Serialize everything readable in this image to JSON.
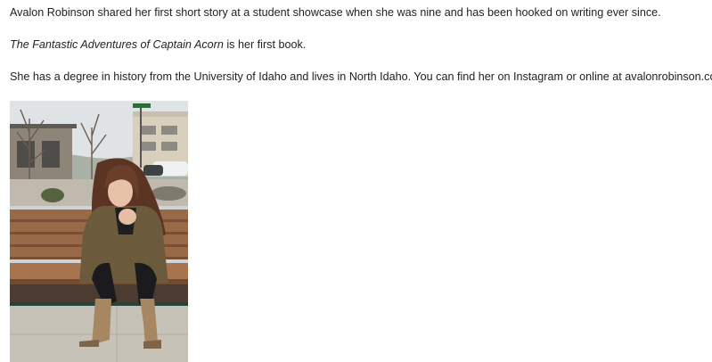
{
  "bio": {
    "paragraph_1": "Avalon Robinson shared her first short story at a student showcase when she was nine and has been hooked on writing ever since.",
    "paragraph_2": {
      "book_title": "The Fantastic Adventures of Captain Acorn",
      "suffix": " is her first book."
    },
    "paragraph_3": "She has a degree in history from the University of Idaho and lives in North Idaho. You can find her on Instagram or online at avalonrobinson.com"
  },
  "colors": {
    "text": "#222222",
    "background": "#ffffff"
  }
}
